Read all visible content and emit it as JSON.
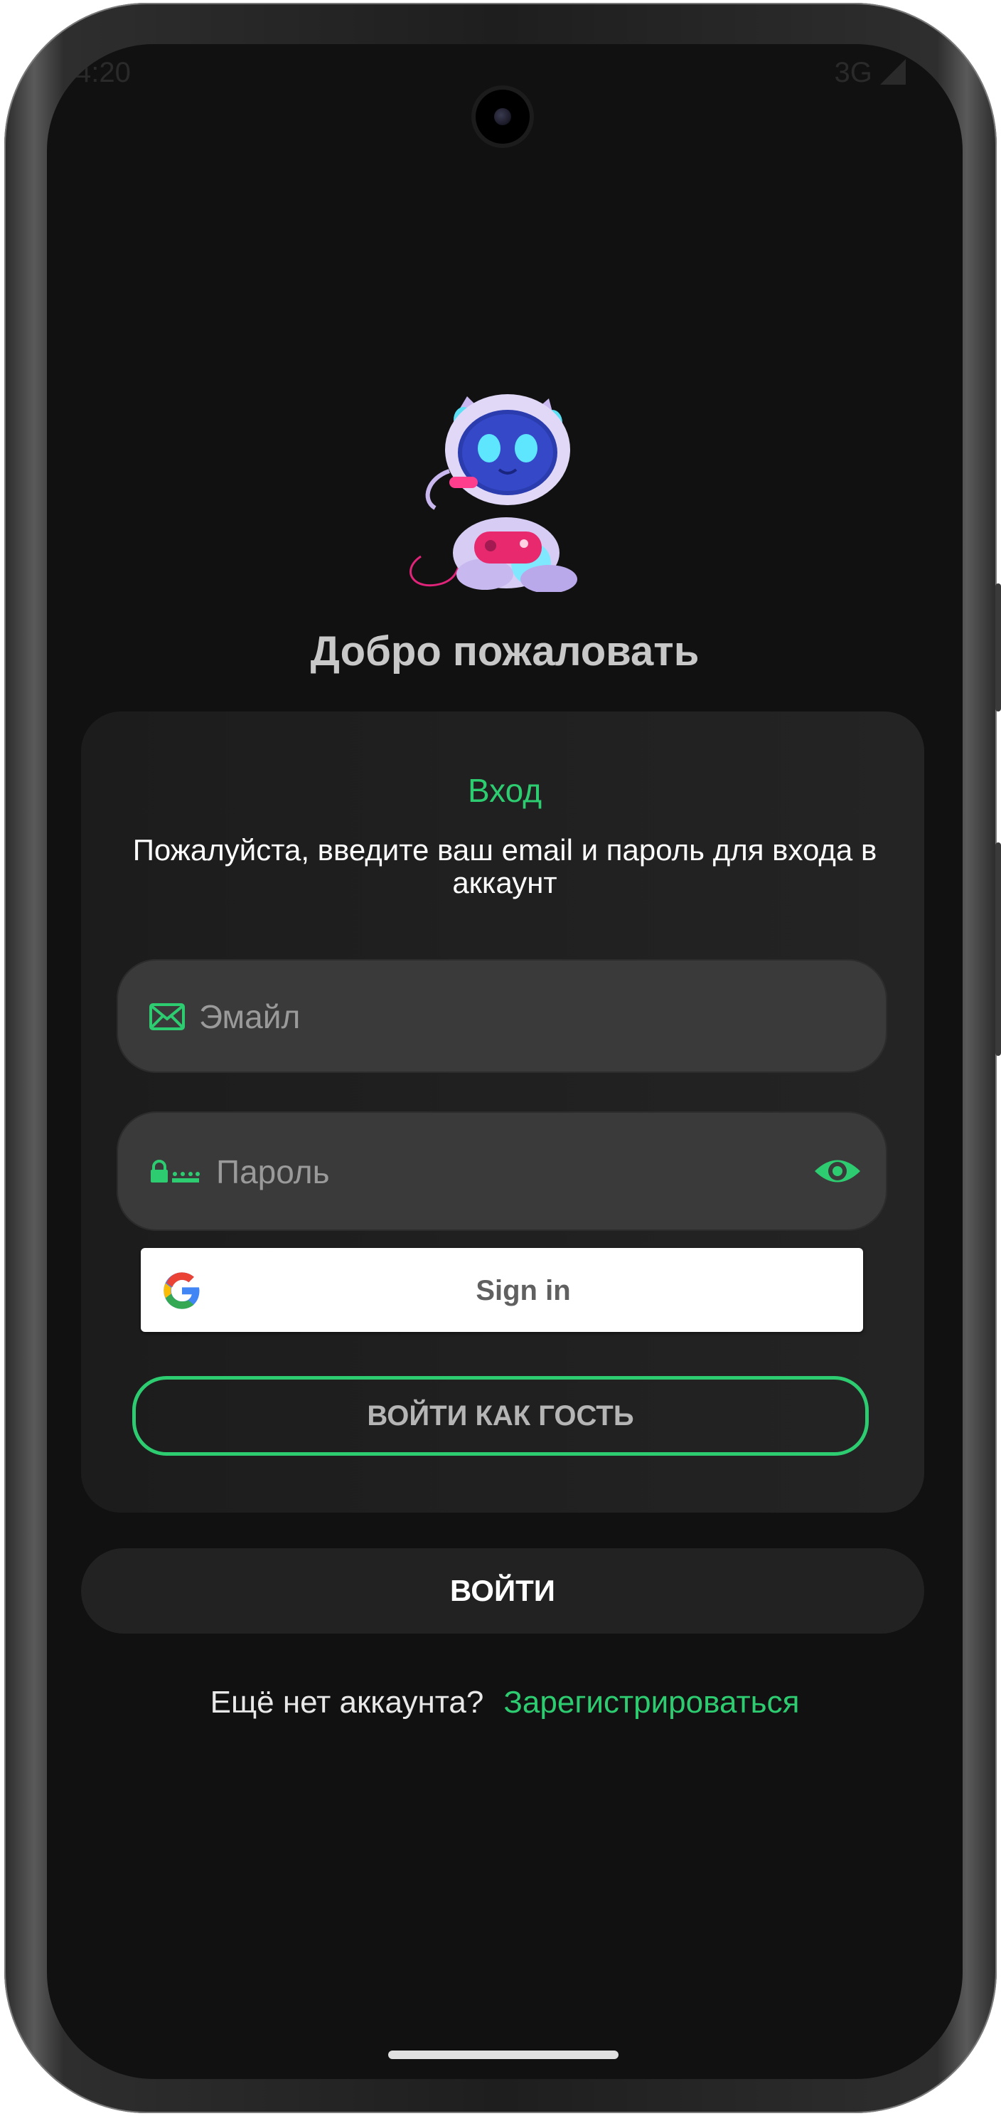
{
  "status_bar": {
    "time": "4:20",
    "network": "3G"
  },
  "welcome_title": "Добро пожаловать",
  "card": {
    "title": "Вход",
    "description": "Пожалуйста, введите ваш email и пароль для входа в аккаунт"
  },
  "email_field": {
    "placeholder": "Эмайл",
    "value": "",
    "icon": "mail-icon"
  },
  "password_field": {
    "placeholder": "Пароль",
    "value": "",
    "icon": "lock-icon",
    "toggle_icon": "eye-icon"
  },
  "google_button": {
    "label": "Sign in",
    "icon": "google-icon"
  },
  "guest_button": {
    "label": "ВОЙТИ КАК ГОСТЬ"
  },
  "login_button": {
    "label": "ВОЙТИ"
  },
  "register": {
    "question": "Ещё нет аккаунта?",
    "link_label": "Зарегистрироваться"
  },
  "colors": {
    "accent": "#2ecc71",
    "background": "#111111",
    "field": "#3a3a3a"
  }
}
